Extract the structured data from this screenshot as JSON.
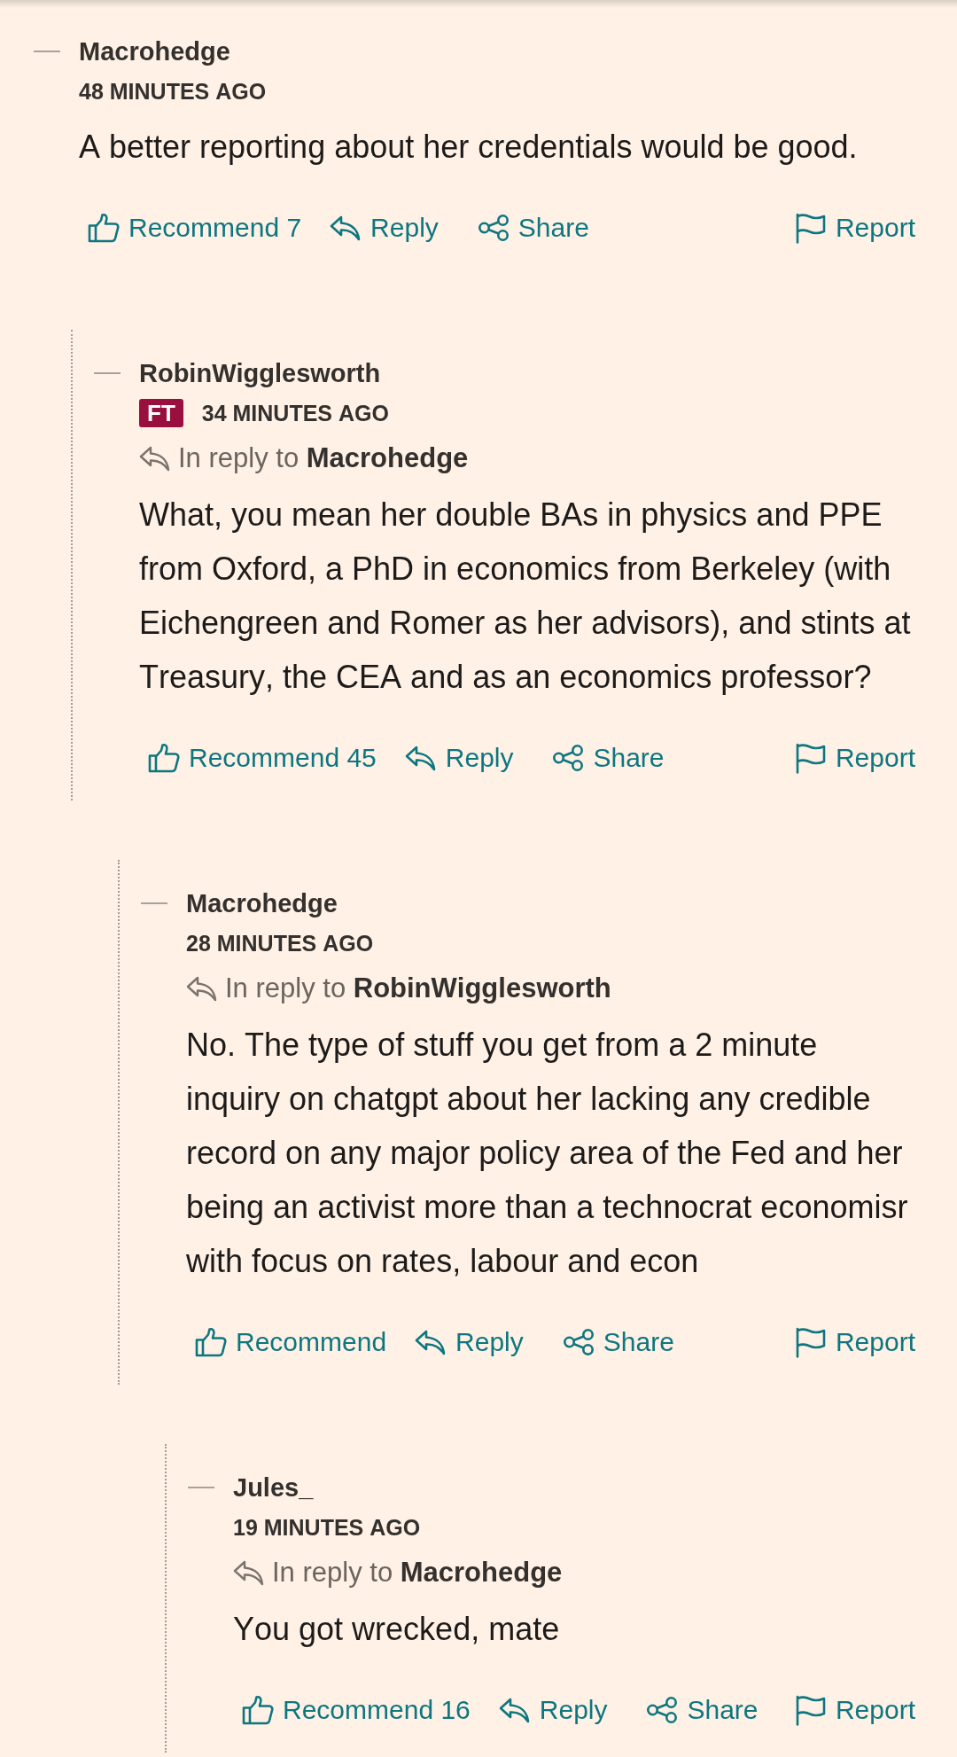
{
  "comments": [
    {
      "username": "Macrohedge",
      "timestamp": "48 MINUTES AGO",
      "text": "A better reporting about her credentials would be good.",
      "actions": [
        {
          "kind": "recommend",
          "label": "Recommend 7"
        },
        {
          "kind": "reply",
          "label": "Reply"
        },
        {
          "kind": "share",
          "label": "Share"
        },
        {
          "kind": "report",
          "label": "Report"
        }
      ],
      "children": [
        {
          "username": "RobinWigglesworth",
          "badge": "FT",
          "timestamp": "34 MINUTES AGO",
          "in_reply_to": "In reply to **Macrohedge**",
          "text": "What, you mean her double BAs in physics and PPE from Oxford, a PhD in economics from Berkeley (with Eichengreen and Romer as her advisors), and stints at Treasury, the CEA and as an economics professor?",
          "actions": [
            {
              "kind": "recommend",
              "label": "Recommend 45"
            },
            {
              "kind": "reply",
              "label": "Reply"
            },
            {
              "kind": "share",
              "label": "Share"
            },
            {
              "kind": "report",
              "label": "Report"
            }
          ],
          "children": [
            {
              "username": "Macrohedge",
              "timestamp": "28 MINUTES AGO",
              "in_reply_to": "In reply to **RobinWigglesworth**",
              "text": "No. The type of stuff you get from a 2 minute inquiry on chatgpt about her lacking any credible record on any major policy area of the Fed and her being an activist more than a technocrat economisr with focus on rates, labour and econ",
              "actions": [
                {
                  "kind": "recommend",
                  "label": "Recommend"
                },
                {
                  "kind": "reply",
                  "label": "Reply"
                },
                {
                  "kind": "share",
                  "label": "Share"
                },
                {
                  "kind": "report",
                  "label": "Report"
                }
              ],
              "children": [
                {
                  "username": "Jules_",
                  "timestamp": "19 MINUTES AGO",
                  "in_reply_to": "In reply to **Macrohedge**",
                  "text": "You got wrecked, mate",
                  "actions": [
                    {
                      "kind": "recommend",
                      "label": "Recommend 16"
                    },
                    {
                      "kind": "reply",
                      "label": "Reply"
                    },
                    {
                      "kind": "share",
                      "label": "Share"
                    },
                    {
                      "kind": "report",
                      "label": "Report"
                    }
                  ]
                }
              ]
            }
          ]
        }
      ]
    }
  ]
}
